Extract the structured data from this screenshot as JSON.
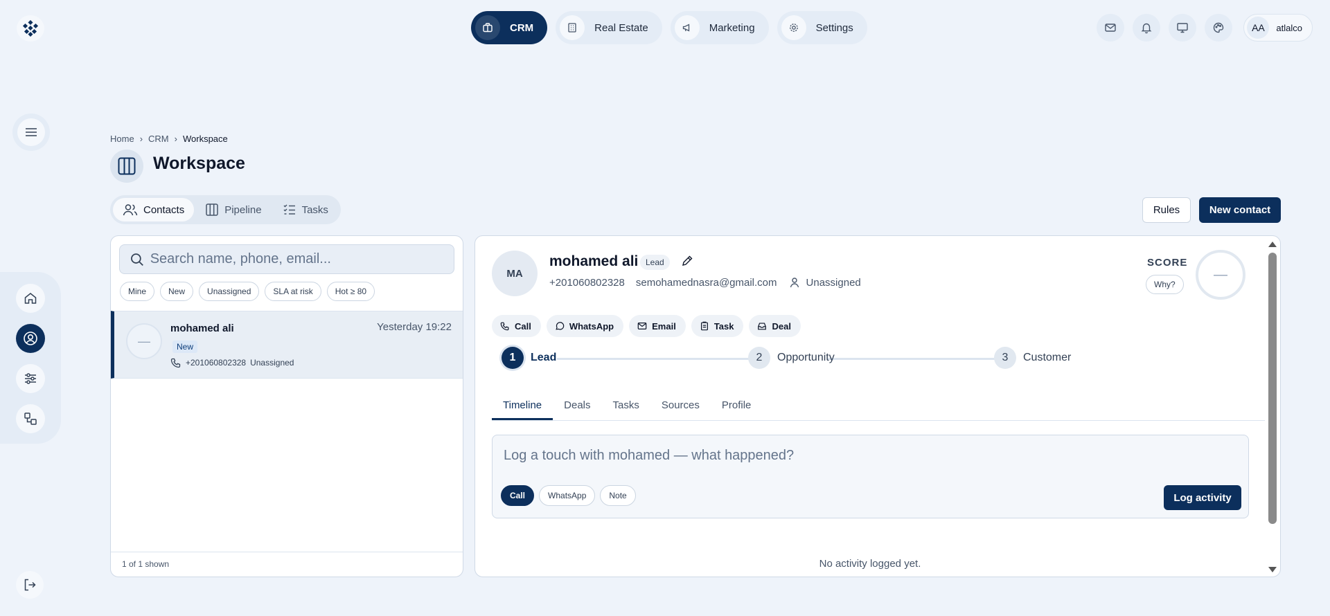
{
  "topnav": [
    {
      "label": "CRM",
      "icon": "briefcase-icon",
      "active": true
    },
    {
      "label": "Real Estate",
      "icon": "building-icon"
    },
    {
      "label": "Marketing",
      "icon": "megaphone-icon"
    },
    {
      "label": "Settings",
      "icon": "gear-icon"
    }
  ],
  "user": {
    "initials": "AA",
    "name": "atlalco"
  },
  "breadcrumb": [
    "Home",
    "CRM",
    "Workspace"
  ],
  "page": {
    "title": "Workspace"
  },
  "viewtabs": [
    {
      "label": "Contacts",
      "active": true
    },
    {
      "label": "Pipeline"
    },
    {
      "label": "Tasks"
    }
  ],
  "actions": {
    "rules": "Rules",
    "new_contact": "New contact"
  },
  "search": {
    "placeholder": "Search name, phone, email..."
  },
  "filters": [
    "Mine",
    "New",
    "Unassigned",
    "SLA at risk",
    "Hot ≥ 80"
  ],
  "contacts": [
    {
      "avatar": "—",
      "name": "mohamed ali",
      "time": "Yesterday 19:22",
      "status": "New",
      "phone": "+201060802328",
      "owner": "Unassigned"
    }
  ],
  "list_footer": "1 of 1 shown",
  "detail": {
    "initials": "MA",
    "name": "mohamed ali",
    "badge": "Lead",
    "phone": "+201060802328",
    "email": "semohamednasra@gmail.com",
    "owner": "Unassigned",
    "score_label": "SCORE",
    "why": "Why?",
    "score_value": "—",
    "quick_actions": [
      "Call",
      "WhatsApp",
      "Email",
      "Task",
      "Deal"
    ],
    "stages": [
      {
        "num": "1",
        "label": "Lead",
        "active": true
      },
      {
        "num": "2",
        "label": "Opportunity"
      },
      {
        "num": "3",
        "label": "Customer"
      }
    ],
    "tabs": [
      "Timeline",
      "Deals",
      "Tasks",
      "Sources",
      "Profile"
    ],
    "log_placeholder": "Log a touch with mohamed — what happened?",
    "log_types": [
      "Call",
      "WhatsApp",
      "Note"
    ],
    "log_button": "Log activity",
    "empty": "No activity logged yet."
  },
  "colors": {
    "primary": "#0c2f5c",
    "background": "#eef3fa",
    "surface": "#ffffff"
  }
}
